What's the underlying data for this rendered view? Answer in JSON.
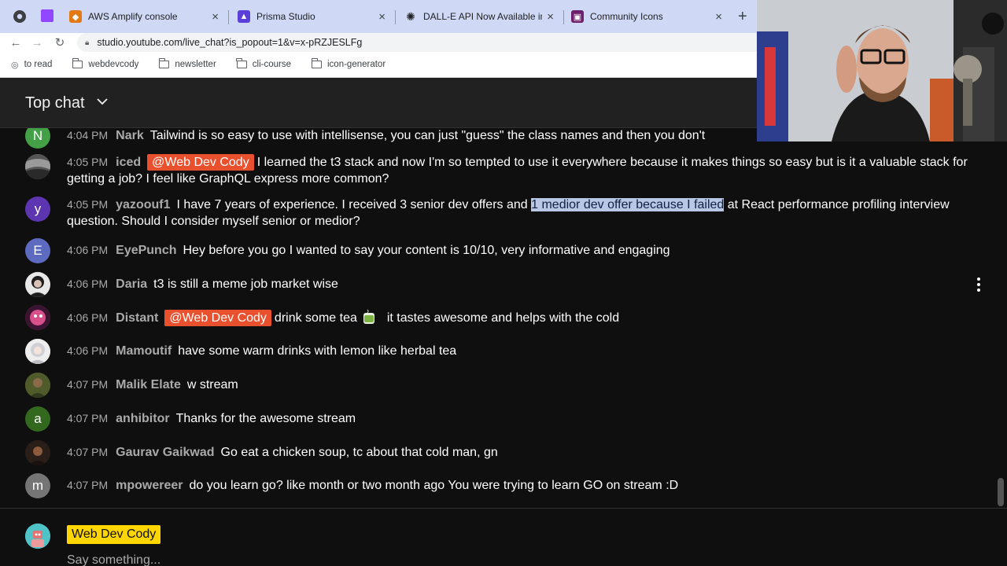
{
  "browser": {
    "tabs": [
      {
        "title": "AWS Amplify console",
        "color": "#e47911"
      },
      {
        "title": "Prisma Studio",
        "color": "#5a3fd8"
      },
      {
        "title": "DALL-E API Now Available in P…",
        "color": "#202124"
      },
      {
        "title": "Community Icons",
        "color": "#6d1f6b"
      }
    ],
    "new_tab": "+",
    "close_glyph": "×",
    "url": "studio.youtube.com/live_chat?is_popout=1&v=x-pRZJESLFg",
    "bookmarks": [
      {
        "label": "to read"
      },
      {
        "label": "webdevcody"
      },
      {
        "label": "newsletter"
      },
      {
        "label": "cli-course"
      },
      {
        "label": "icon-generator"
      }
    ]
  },
  "chat": {
    "header_title": "Top chat",
    "messages": [
      {
        "time": "4:04 PM",
        "author": "Nark",
        "avatar_letter": "N",
        "avatar_color": "#43a047",
        "mention": "",
        "text": "Tailwind is so easy to use with intellisense, you can just \"guess\" the class names and then you don't"
      },
      {
        "time": "4:05 PM",
        "author": "iced",
        "avatar_letter": "",
        "avatar_color": "#6d6d6d",
        "mention": "@Web Dev Cody",
        "text": "I learned the t3 stack and now I'm so tempted to use it everywhere because it makes things so easy but is it a valuable stack for getting a job? I feel like GraphQL express more common?"
      },
      {
        "time": "4:05 PM",
        "author": "yazoouf1",
        "avatar_letter": "y",
        "avatar_color": "#5e35b1",
        "mention": "",
        "text_before": "I have 7 years of experience. I received 3 senior dev offers and",
        "text_highlight": "1 medior dev offer because I failed",
        "text_after": "at React performance profiling interview question. Should I consider myself senior or medior?"
      },
      {
        "time": "4:06 PM",
        "author": "EyePunch",
        "avatar_letter": "E",
        "avatar_color": "#5c6bc0",
        "mention": "",
        "text": "Hey before you go I wanted to say your content is 10/10, very informative and engaging"
      },
      {
        "time": "4:06 PM",
        "author": "Daria",
        "avatar_letter": "",
        "avatar_color": "#3a3a3a",
        "mention": "",
        "text": "t3 is still a meme job market wise"
      },
      {
        "time": "4:06 PM",
        "author": "Distant",
        "avatar_letter": "",
        "avatar_color": "#b0306a",
        "mention": "@Web Dev Cody",
        "text": "drink some tea",
        "text_after": "it tastes awesome and helps with the cold"
      },
      {
        "time": "4:06 PM",
        "author": "Mamoutif",
        "avatar_letter": "",
        "avatar_color": "#d8d8d8",
        "mention": "",
        "text": "have some warm drinks with lemon like herbal tea"
      },
      {
        "time": "4:07 PM",
        "author": "Malik Elate",
        "avatar_letter": "",
        "avatar_color": "#6b7a3a",
        "mention": "",
        "text": "w stream"
      },
      {
        "time": "4:07 PM",
        "author": "anhibitor",
        "avatar_letter": "a",
        "avatar_color": "#33691e",
        "mention": "",
        "text": "Thanks for the awesome stream"
      },
      {
        "time": "4:07 PM",
        "author": "Gaurav Gaikwad",
        "avatar_letter": "",
        "avatar_color": "#3d2a22",
        "mention": "",
        "text": "Go eat a chicken soup, tc about that cold man, gn"
      },
      {
        "time": "4:07 PM",
        "author": "mpowereer",
        "avatar_letter": "m",
        "avatar_color": "#757575",
        "mention": "",
        "text": "do you learn go? like month or two month ago You were trying to learn GO on stream :D"
      }
    ],
    "composer": {
      "channel_name": "Web Dev Cody",
      "placeholder": "Say something..."
    }
  }
}
